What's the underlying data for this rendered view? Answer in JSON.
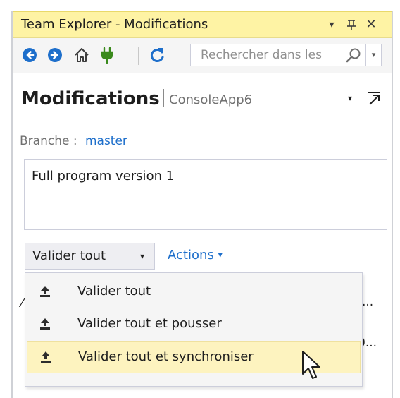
{
  "window": {
    "title": "Team Explorer - Modifications",
    "title_buttons": [
      "▾",
      "ᛘ",
      "✕"
    ],
    "title_bar_color": "#fef3a4"
  },
  "toolbar": {
    "icons": [
      "back-icon",
      "forward-icon",
      "home-icon",
      "connect-icon",
      "refresh-icon"
    ],
    "search_placeholder": "Rechercher dans les",
    "search_dropdown_glyph": "▾",
    "accent": "#1e6fcb"
  },
  "header": {
    "title": "Modifications",
    "repo": "ConsoleApp6",
    "dropdown_glyph": "▾"
  },
  "branch": {
    "label": "Branche :",
    "value": "master"
  },
  "commit_message": "Full program version 1",
  "commit_split": {
    "label": "Valider tout",
    "arrow_glyph": "▾"
  },
  "actions": {
    "label": "Actions",
    "caret": "▾"
  },
  "background_list": {
    "left_fragment": "⁄",
    "row1_suffix": "...",
    "row2_suffix": "0..."
  },
  "menu": {
    "items": [
      {
        "label": "Valider tout",
        "icon": "upload-icon",
        "highlighted": false
      },
      {
        "label": "Valider tout et pousser",
        "icon": "upload-icon",
        "highlighted": false
      },
      {
        "label": "Valider tout et synchroniser",
        "icon": "upload-icon",
        "highlighted": true
      }
    ],
    "highlight_color": "#fdf3bf"
  }
}
